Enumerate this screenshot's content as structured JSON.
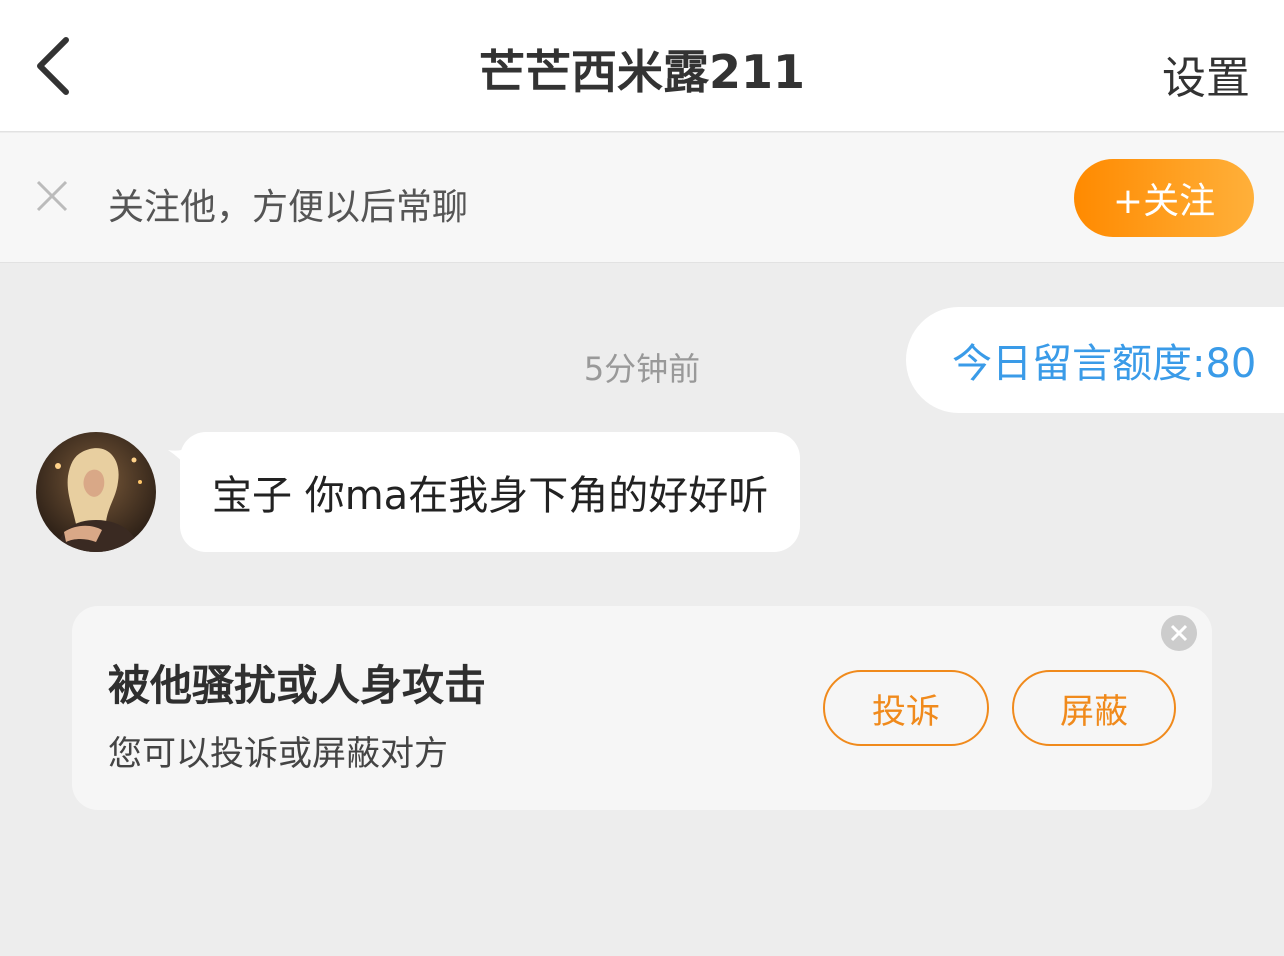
{
  "header": {
    "back_icon": "chevron-left-icon",
    "title": "芒芒西米露211",
    "settings_label": "设置"
  },
  "follow_bar": {
    "close_icon": "close-icon",
    "text": "关注他，方便以后常聊",
    "button_label": "+关注",
    "button_colors": [
      "#ff8a00",
      "#ffb03a"
    ]
  },
  "chat": {
    "quota_text": "今日留言额度:80",
    "quota_color": "#3a9be8",
    "timestamp": "5分钟前",
    "messages": [
      {
        "sender": "other",
        "avatar_icon": "user-avatar",
        "text": "宝子 你ma在我身下角的好好听"
      }
    ]
  },
  "harassment_card": {
    "title": "被他骚扰或人身攻击",
    "subtitle": "您可以投诉或屏蔽对方",
    "report_label": "投诉",
    "block_label": "屏蔽",
    "accent_color": "#f08a1c",
    "close_icon": "close-circle-icon"
  }
}
